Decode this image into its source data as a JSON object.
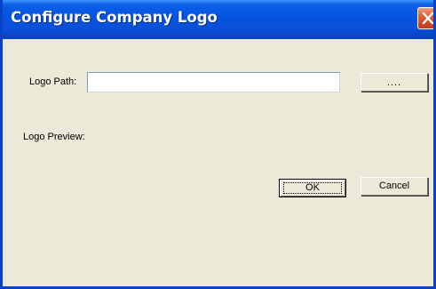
{
  "dialog": {
    "title": "Configure Company Logo",
    "close_icon": "close-x-icon"
  },
  "form": {
    "logo_path_label": "Logo Path:",
    "logo_path_value": "",
    "logo_path_placeholder": "",
    "browse_label": "....",
    "logo_preview_label": "Logo Preview:"
  },
  "buttons": {
    "ok_label": "OK",
    "cancel_label": "Cancel"
  },
  "colors": {
    "titlebar": "#0554e0",
    "close_button": "#e2613a",
    "dialog_background": "#ece9d8"
  }
}
